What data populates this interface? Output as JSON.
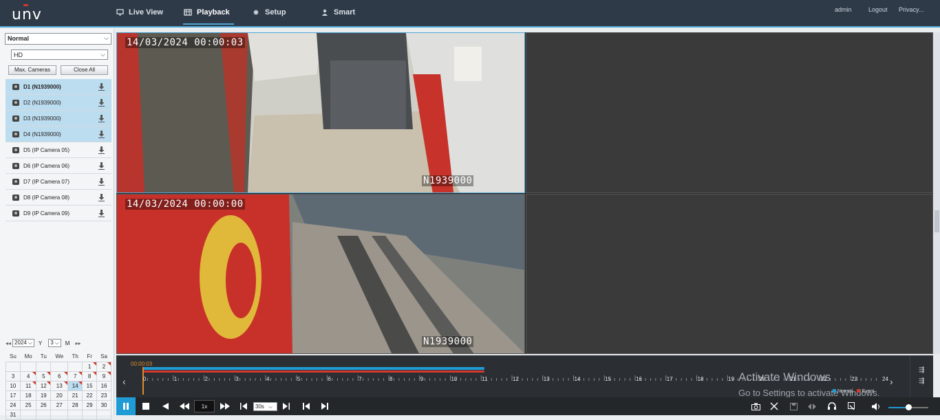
{
  "brand": "unv",
  "nav": [
    {
      "label": "Live View",
      "icon": "monitor-icon"
    },
    {
      "label": "Playback",
      "icon": "film-icon",
      "active": true
    },
    {
      "label": "Setup",
      "icon": "gear-icon"
    },
    {
      "label": "Smart",
      "icon": "person-icon"
    }
  ],
  "top_links": {
    "user": "admin",
    "logout": "Logout",
    "privacy": "Privacy..."
  },
  "sidebar": {
    "mode_select": "Normal",
    "stream_select": "HD",
    "max_cameras": "Max. Cameras",
    "close_all": "Close All",
    "cameras": [
      {
        "label": "D1 (N1939000)",
        "selected": true
      },
      {
        "label": "D2 (N1939000)",
        "selected": true
      },
      {
        "label": "D3 (N1939000)",
        "selected": true
      },
      {
        "label": "D4 (N1939000)",
        "selected": true
      },
      {
        "label": "D5 (IP Camera 05)",
        "selected": false
      },
      {
        "label": "D6 (IP Camera 06)",
        "selected": false
      },
      {
        "label": "D7 (IP Camera 07)",
        "selected": false
      },
      {
        "label": "D8 (IP Camera 08)",
        "selected": false
      },
      {
        "label": "D9 (IP Camera 09)",
        "selected": false
      }
    ]
  },
  "calendar": {
    "year": "2024",
    "year_label": "Y",
    "month": "3",
    "month_label": "M",
    "weekdays": [
      "Su",
      "Mo",
      "Tu",
      "We",
      "Th",
      "Fr",
      "Sa"
    ],
    "weeks": [
      [
        "",
        "",
        "",
        "",
        "",
        "1",
        "2"
      ],
      [
        "3",
        "4",
        "5",
        "6",
        "7",
        "8",
        "9"
      ],
      [
        "10",
        "11",
        "12",
        "13",
        "14",
        "15",
        "16"
      ],
      [
        "17",
        "18",
        "19",
        "20",
        "21",
        "22",
        "23"
      ],
      [
        "24",
        "25",
        "26",
        "27",
        "28",
        "29",
        "30"
      ],
      [
        "31",
        "",
        "",
        "",
        "",
        "",
        ""
      ]
    ],
    "recorded_days": [
      "1",
      "2",
      "4",
      "5",
      "6",
      "7",
      "8",
      "9",
      "11",
      "12",
      "13",
      "14"
    ],
    "selected_day": "14"
  },
  "video": {
    "pane1_timestamp": "14/03/2024  00:00:03",
    "pane1_name": "N1939000",
    "pane2_timestamp": "14/03/2024  00:00:00",
    "pane2_name": "N1939000"
  },
  "timeline": {
    "current_time": "00:00:03",
    "hours": [
      "0",
      "1",
      "2",
      "3",
      "4",
      "5",
      "6",
      "7",
      "8",
      "9",
      "10",
      "11",
      "12",
      "13",
      "14",
      "15",
      "16",
      "17",
      "18",
      "19",
      "20",
      "21",
      "22",
      "23",
      "24"
    ],
    "recorded_until_hour": 11.1,
    "legend_normal": "Normal",
    "legend_event": "Event"
  },
  "controls": {
    "speed": "1x",
    "interval": "30s"
  },
  "watermark": {
    "line1": "Activate Windows",
    "line2": "Go to Settings to activate Windows."
  }
}
